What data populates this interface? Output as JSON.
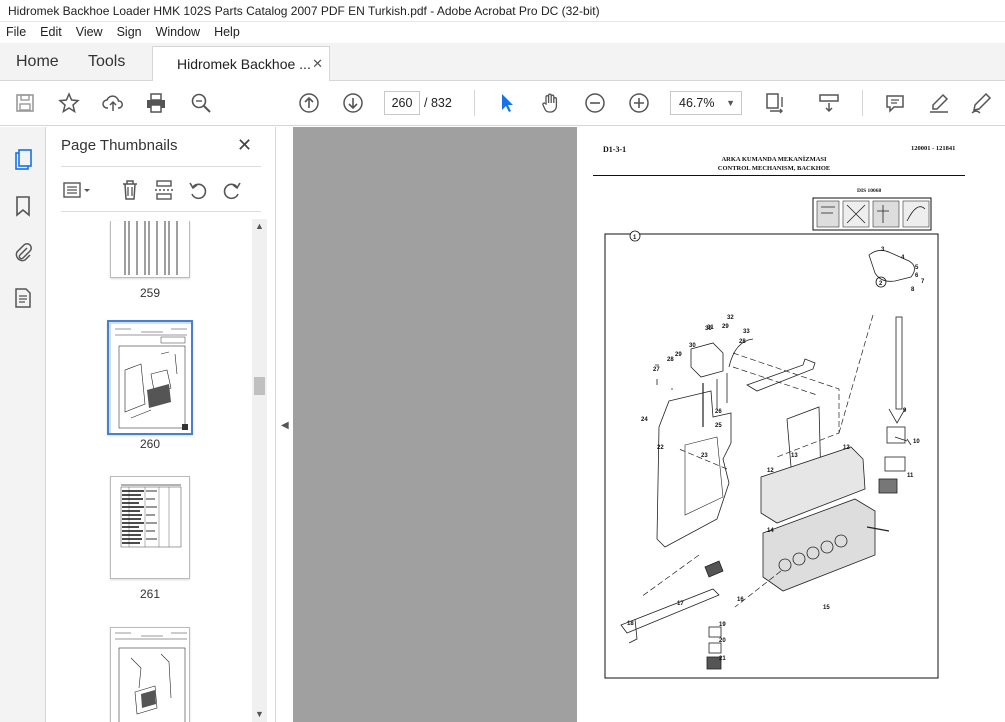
{
  "window": {
    "title": "Hidromek Backhoe Loader HMK 102S Parts Catalog 2007 PDF EN Turkish.pdf - Adobe Acrobat Pro DC (32-bit)"
  },
  "menu": [
    "File",
    "Edit",
    "View",
    "Sign",
    "Window",
    "Help"
  ],
  "tabs": {
    "home": "Home",
    "tools": "Tools",
    "document": "Hidromek Backhoe ...",
    "close": "✕"
  },
  "toolbar": {
    "current_page": "260",
    "total_pages": "/ 832",
    "zoom": "46.7%",
    "zoom_caret": "▼"
  },
  "panel": {
    "title": "Page Thumbnails",
    "close": "✕",
    "thumbnails": [
      {
        "label": "259"
      },
      {
        "label": "260"
      },
      {
        "label": "261"
      }
    ]
  },
  "page": {
    "code_left": "D1-3-1",
    "code_right": "120001 - 121841",
    "title_tr": "ARKA KUMANDA MEKANİZMASI",
    "title_en": "CONTROL MECHANISM, BACKHOE",
    "dis_label": "DIS 10068",
    "callouts": [
      "1",
      "2",
      "3",
      "4",
      "5",
      "6",
      "7",
      "8",
      "9",
      "10",
      "11",
      "12",
      "12",
      "13",
      "14",
      "15",
      "16",
      "17",
      "18",
      "19",
      "20",
      "21",
      "22",
      "23",
      "24",
      "25",
      "26",
      "27",
      "28",
      "29",
      "30",
      "31",
      "32",
      "33",
      "28",
      "29",
      "30"
    ]
  },
  "colors": {
    "accent": "#1473e6",
    "chrome": "#f3f3f3",
    "viewer_bg": "#a0a0a0",
    "selection": "#4a7fcf"
  }
}
